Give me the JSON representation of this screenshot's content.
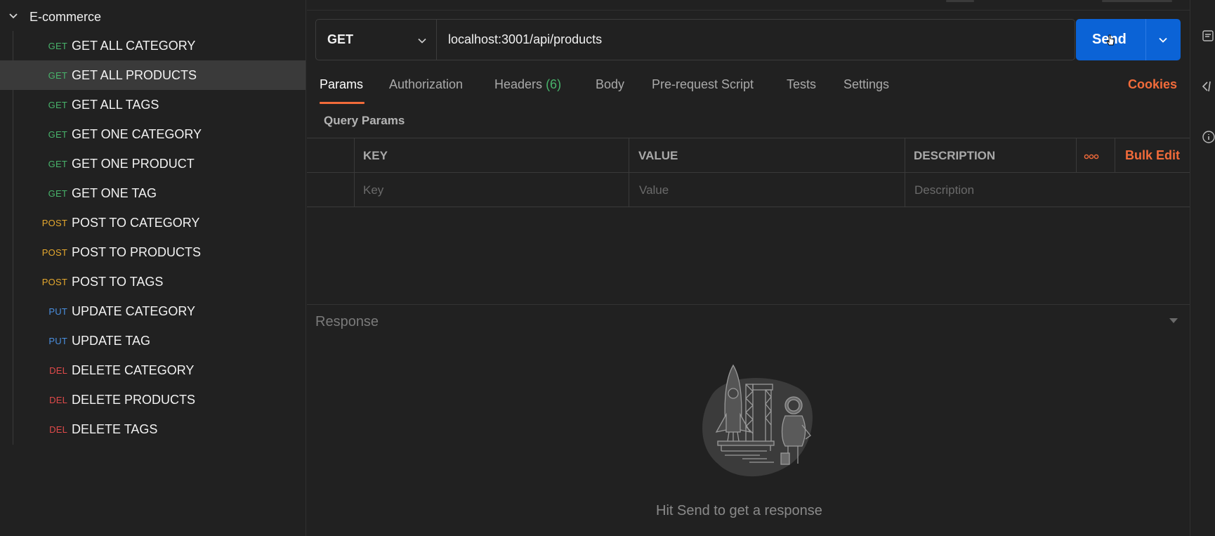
{
  "sidebar": {
    "collection": "E-commerce",
    "requests": [
      {
        "method": "GET",
        "label": "GET ALL CATEGORY"
      },
      {
        "method": "GET",
        "label": "GET ALL PRODUCTS"
      },
      {
        "method": "GET",
        "label": "GET ALL TAGS"
      },
      {
        "method": "GET",
        "label": "GET ONE CATEGORY"
      },
      {
        "method": "GET",
        "label": "GET ONE PRODUCT"
      },
      {
        "method": "GET",
        "label": "GET ONE TAG"
      },
      {
        "method": "POST",
        "label": "POST TO CATEGORY"
      },
      {
        "method": "POST",
        "label": "POST TO PRODUCTS"
      },
      {
        "method": "POST",
        "label": "POST TO TAGS"
      },
      {
        "method": "PUT",
        "label": "UPDATE CATEGORY"
      },
      {
        "method": "PUT",
        "label": "UPDATE TAG"
      },
      {
        "method": "DEL",
        "label": "DELETE CATEGORY"
      },
      {
        "method": "DEL",
        "label": "DELETE PRODUCTS"
      },
      {
        "method": "DEL",
        "label": "DELETE TAGS"
      }
    ],
    "active_index": 1
  },
  "request": {
    "method": "GET",
    "url": "localhost:3001/api/products",
    "send_label": "Send"
  },
  "tabs": {
    "params": "Params",
    "authorization": "Authorization",
    "headers": "Headers",
    "headers_count": "(6)",
    "body": "Body",
    "prerequest": "Pre-request Script",
    "tests": "Tests",
    "settings": "Settings",
    "cookies": "Cookies"
  },
  "params": {
    "title": "Query Params",
    "col_key": "KEY",
    "col_value": "VALUE",
    "col_description": "DESCRIPTION",
    "bulk_edit": "Bulk Edit",
    "key_placeholder": "Key",
    "value_placeholder": "Value",
    "description_placeholder": "Description"
  },
  "response": {
    "label": "Response",
    "hint": "Hit Send to get a response"
  },
  "colors": {
    "get": "#48b36b",
    "post": "#e5a82e",
    "put": "#4a8fdf",
    "del": "#e04a4a",
    "accent": "#f26b3a",
    "send": "#0b63d6"
  },
  "icons": {
    "collection_toggle": "chevron-down-icon",
    "method_dropdown": "chevron-down-icon",
    "send_dropdown": "chevron-down-icon",
    "more": "more-horizontal-icon",
    "response_toggle": "caret-down-icon"
  }
}
